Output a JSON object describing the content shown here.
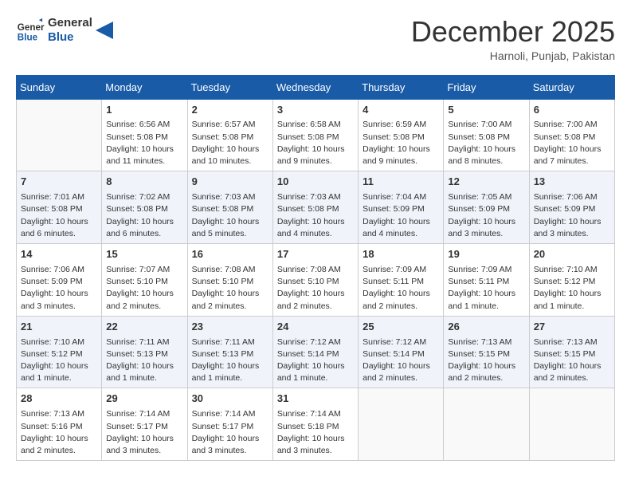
{
  "header": {
    "logo_line1": "General",
    "logo_line2": "Blue",
    "month": "December 2025",
    "location": "Harnoli, Punjab, Pakistan"
  },
  "days_of_week": [
    "Sunday",
    "Monday",
    "Tuesday",
    "Wednesday",
    "Thursday",
    "Friday",
    "Saturday"
  ],
  "weeks": [
    [
      {
        "day": "",
        "sunrise": "",
        "sunset": "",
        "daylight": ""
      },
      {
        "day": "1",
        "sunrise": "Sunrise: 6:56 AM",
        "sunset": "Sunset: 5:08 PM",
        "daylight": "Daylight: 10 hours and 11 minutes."
      },
      {
        "day": "2",
        "sunrise": "Sunrise: 6:57 AM",
        "sunset": "Sunset: 5:08 PM",
        "daylight": "Daylight: 10 hours and 10 minutes."
      },
      {
        "day": "3",
        "sunrise": "Sunrise: 6:58 AM",
        "sunset": "Sunset: 5:08 PM",
        "daylight": "Daylight: 10 hours and 9 minutes."
      },
      {
        "day": "4",
        "sunrise": "Sunrise: 6:59 AM",
        "sunset": "Sunset: 5:08 PM",
        "daylight": "Daylight: 10 hours and 9 minutes."
      },
      {
        "day": "5",
        "sunrise": "Sunrise: 7:00 AM",
        "sunset": "Sunset: 5:08 PM",
        "daylight": "Daylight: 10 hours and 8 minutes."
      },
      {
        "day": "6",
        "sunrise": "Sunrise: 7:00 AM",
        "sunset": "Sunset: 5:08 PM",
        "daylight": "Daylight: 10 hours and 7 minutes."
      }
    ],
    [
      {
        "day": "7",
        "sunrise": "Sunrise: 7:01 AM",
        "sunset": "Sunset: 5:08 PM",
        "daylight": "Daylight: 10 hours and 6 minutes."
      },
      {
        "day": "8",
        "sunrise": "Sunrise: 7:02 AM",
        "sunset": "Sunset: 5:08 PM",
        "daylight": "Daylight: 10 hours and 6 minutes."
      },
      {
        "day": "9",
        "sunrise": "Sunrise: 7:03 AM",
        "sunset": "Sunset: 5:08 PM",
        "daylight": "Daylight: 10 hours and 5 minutes."
      },
      {
        "day": "10",
        "sunrise": "Sunrise: 7:03 AM",
        "sunset": "Sunset: 5:08 PM",
        "daylight": "Daylight: 10 hours and 4 minutes."
      },
      {
        "day": "11",
        "sunrise": "Sunrise: 7:04 AM",
        "sunset": "Sunset: 5:09 PM",
        "daylight": "Daylight: 10 hours and 4 minutes."
      },
      {
        "day": "12",
        "sunrise": "Sunrise: 7:05 AM",
        "sunset": "Sunset: 5:09 PM",
        "daylight": "Daylight: 10 hours and 3 minutes."
      },
      {
        "day": "13",
        "sunrise": "Sunrise: 7:06 AM",
        "sunset": "Sunset: 5:09 PM",
        "daylight": "Daylight: 10 hours and 3 minutes."
      }
    ],
    [
      {
        "day": "14",
        "sunrise": "Sunrise: 7:06 AM",
        "sunset": "Sunset: 5:09 PM",
        "daylight": "Daylight: 10 hours and 3 minutes."
      },
      {
        "day": "15",
        "sunrise": "Sunrise: 7:07 AM",
        "sunset": "Sunset: 5:10 PM",
        "daylight": "Daylight: 10 hours and 2 minutes."
      },
      {
        "day": "16",
        "sunrise": "Sunrise: 7:08 AM",
        "sunset": "Sunset: 5:10 PM",
        "daylight": "Daylight: 10 hours and 2 minutes."
      },
      {
        "day": "17",
        "sunrise": "Sunrise: 7:08 AM",
        "sunset": "Sunset: 5:10 PM",
        "daylight": "Daylight: 10 hours and 2 minutes."
      },
      {
        "day": "18",
        "sunrise": "Sunrise: 7:09 AM",
        "sunset": "Sunset: 5:11 PM",
        "daylight": "Daylight: 10 hours and 2 minutes."
      },
      {
        "day": "19",
        "sunrise": "Sunrise: 7:09 AM",
        "sunset": "Sunset: 5:11 PM",
        "daylight": "Daylight: 10 hours and 1 minute."
      },
      {
        "day": "20",
        "sunrise": "Sunrise: 7:10 AM",
        "sunset": "Sunset: 5:12 PM",
        "daylight": "Daylight: 10 hours and 1 minute."
      }
    ],
    [
      {
        "day": "21",
        "sunrise": "Sunrise: 7:10 AM",
        "sunset": "Sunset: 5:12 PM",
        "daylight": "Daylight: 10 hours and 1 minute."
      },
      {
        "day": "22",
        "sunrise": "Sunrise: 7:11 AM",
        "sunset": "Sunset: 5:13 PM",
        "daylight": "Daylight: 10 hours and 1 minute."
      },
      {
        "day": "23",
        "sunrise": "Sunrise: 7:11 AM",
        "sunset": "Sunset: 5:13 PM",
        "daylight": "Daylight: 10 hours and 1 minute."
      },
      {
        "day": "24",
        "sunrise": "Sunrise: 7:12 AM",
        "sunset": "Sunset: 5:14 PM",
        "daylight": "Daylight: 10 hours and 1 minute."
      },
      {
        "day": "25",
        "sunrise": "Sunrise: 7:12 AM",
        "sunset": "Sunset: 5:14 PM",
        "daylight": "Daylight: 10 hours and 2 minutes."
      },
      {
        "day": "26",
        "sunrise": "Sunrise: 7:13 AM",
        "sunset": "Sunset: 5:15 PM",
        "daylight": "Daylight: 10 hours and 2 minutes."
      },
      {
        "day": "27",
        "sunrise": "Sunrise: 7:13 AM",
        "sunset": "Sunset: 5:15 PM",
        "daylight": "Daylight: 10 hours and 2 minutes."
      }
    ],
    [
      {
        "day": "28",
        "sunrise": "Sunrise: 7:13 AM",
        "sunset": "Sunset: 5:16 PM",
        "daylight": "Daylight: 10 hours and 2 minutes."
      },
      {
        "day": "29",
        "sunrise": "Sunrise: 7:14 AM",
        "sunset": "Sunset: 5:17 PM",
        "daylight": "Daylight: 10 hours and 3 minutes."
      },
      {
        "day": "30",
        "sunrise": "Sunrise: 7:14 AM",
        "sunset": "Sunset: 5:17 PM",
        "daylight": "Daylight: 10 hours and 3 minutes."
      },
      {
        "day": "31",
        "sunrise": "Sunrise: 7:14 AM",
        "sunset": "Sunset: 5:18 PM",
        "daylight": "Daylight: 10 hours and 3 minutes."
      },
      {
        "day": "",
        "sunrise": "",
        "sunset": "",
        "daylight": ""
      },
      {
        "day": "",
        "sunrise": "",
        "sunset": "",
        "daylight": ""
      },
      {
        "day": "",
        "sunrise": "",
        "sunset": "",
        "daylight": ""
      }
    ]
  ]
}
